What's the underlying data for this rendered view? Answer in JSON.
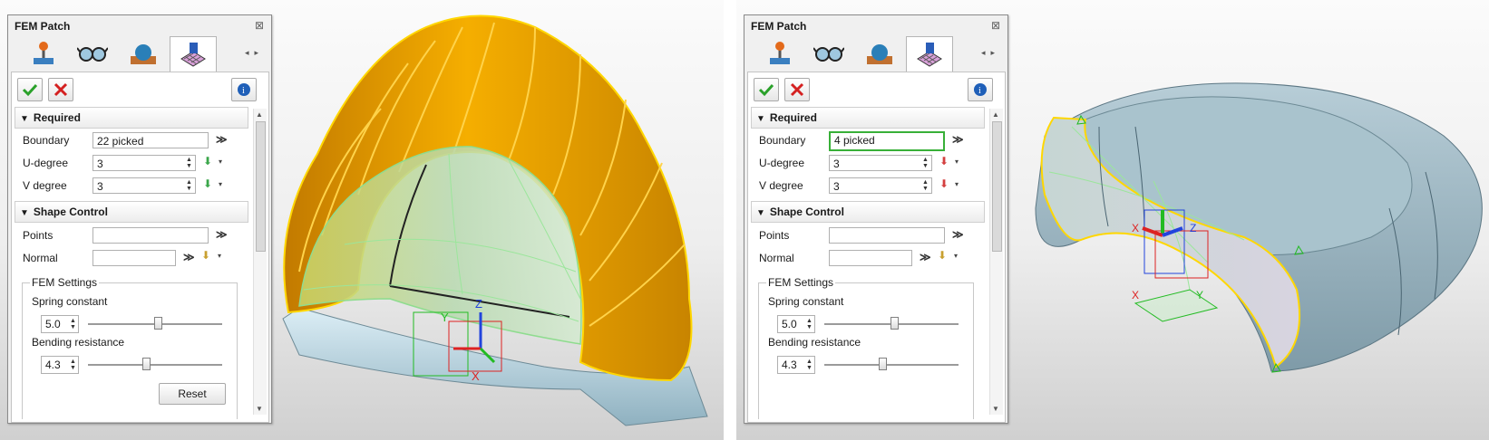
{
  "colors": {
    "orange_surface": "#f2a200",
    "boundary_yellow": "#ffd700",
    "fem_patch_green": "#7fbf7f",
    "blue_gray_surface": "#8fb1c0",
    "accept_green": "#2aa12a",
    "cancel_red": "#d42020",
    "field_green_border": "#38b038"
  },
  "left": {
    "panel": {
      "title": "FEM Patch",
      "close_icon": "close-icon",
      "tab_icons": [
        "joystick-icon",
        "glasses-icon",
        "sphere-icon",
        "fem-patch-icon"
      ],
      "required_label": "Required",
      "boundary_label": "Boundary",
      "boundary_value": "22 picked",
      "udegree_label": "U-degree",
      "udegree_value": "3",
      "vdegree_label": "V degree",
      "vdegree_value": "3",
      "shape_control_label": "Shape Control",
      "points_label": "Points",
      "points_value": "",
      "normal_label": "Normal",
      "normal_value": "",
      "fem_settings_label": "FEM Settings",
      "spring_label": "Spring constant",
      "spring_value": "5.0",
      "spring_level": 0.52,
      "bending_label": "Bending resistance",
      "bending_value": "4.3",
      "bending_level": 0.43,
      "reset_label": "Reset"
    },
    "axes": {
      "x": "X",
      "y": "Y",
      "z": "Z"
    }
  },
  "right": {
    "panel": {
      "title": "FEM Patch",
      "close_icon": "close-icon",
      "tab_icons": [
        "joystick-icon",
        "glasses-icon",
        "sphere-icon",
        "fem-patch-icon"
      ],
      "required_label": "Required",
      "boundary_label": "Boundary",
      "boundary_value": "4 picked",
      "udegree_label": "U-degree",
      "udegree_value": "3",
      "vdegree_label": "V degree",
      "vdegree_value": "3",
      "shape_control_label": "Shape Control",
      "points_label": "Points",
      "points_value": "",
      "normal_label": "Normal",
      "normal_value": "",
      "fem_settings_label": "FEM Settings",
      "spring_label": "Spring constant",
      "spring_value": "5.0",
      "spring_level": 0.52,
      "bending_label": "Bending resistance",
      "bending_value": "4.3",
      "bending_level": 0.43
    },
    "axes": {
      "x": "X",
      "y": "Y",
      "z": "Z"
    }
  }
}
